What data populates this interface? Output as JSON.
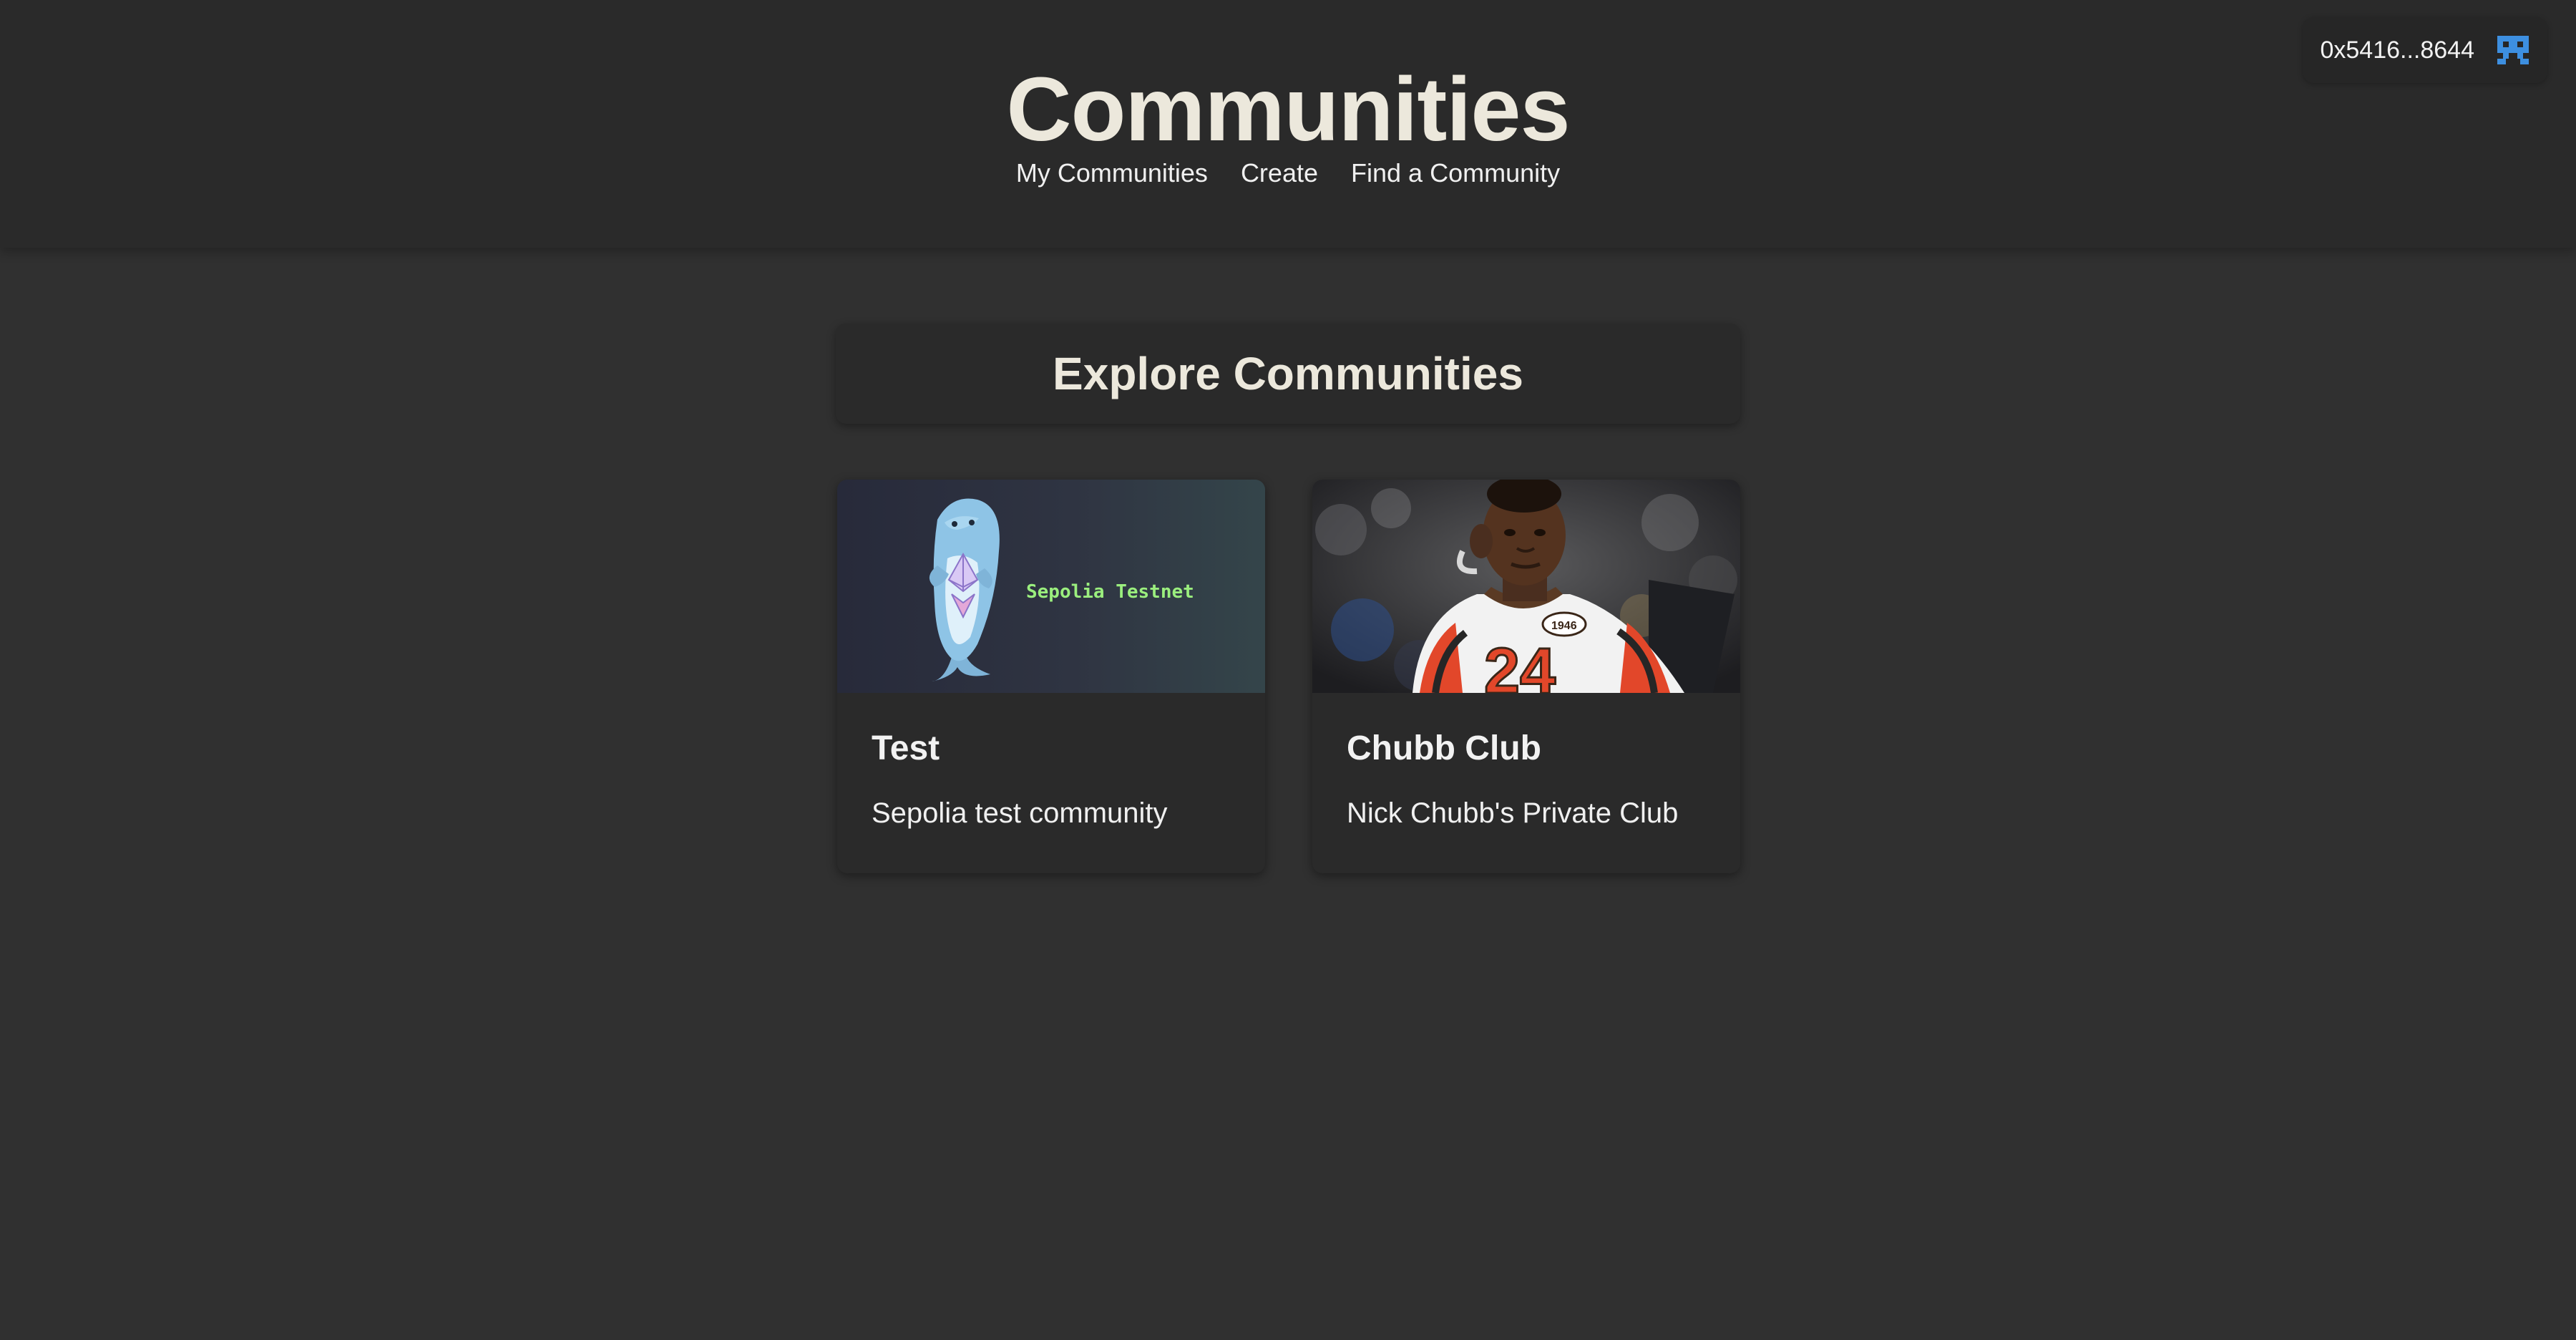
{
  "header": {
    "title": "Communities",
    "nav": [
      {
        "label": "My Communities"
      },
      {
        "label": "Create"
      },
      {
        "label": "Find a Community"
      }
    ]
  },
  "wallet": {
    "address": "0x5416...8644",
    "icon": "pixel-avatar-icon",
    "icon_color": "#3d8fe0"
  },
  "main": {
    "section_title": "Explore Communities",
    "communities": [
      {
        "name": "Test",
        "description": "Sepolia test community",
        "image_text": "Sepolia Testnet"
      },
      {
        "name": "Chubb Club",
        "description": "Nick Chubb's Private Club",
        "jersey_number": "24",
        "patch_text": "1946"
      }
    ]
  },
  "colors": {
    "background": "#303030",
    "header": "#2a2a2a",
    "card": "#2a2a2a",
    "title_text": "#ece8dc",
    "label_green": "#9bef7e",
    "browns_orange": "#e2472a"
  }
}
